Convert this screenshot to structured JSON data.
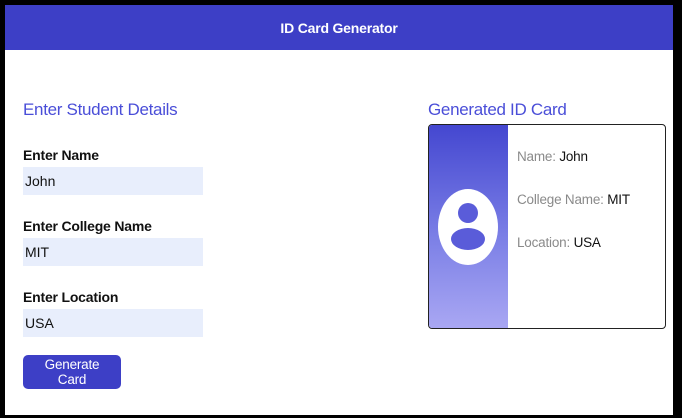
{
  "header": {
    "title": "ID Card Generator"
  },
  "form": {
    "section_title": "Enter Student Details",
    "name_label": "Enter Name",
    "name_value": "John",
    "college_label": "Enter College Name",
    "college_value": "MIT",
    "location_label": "Enter Location",
    "location_value": "USA",
    "button_label": "Generate Card"
  },
  "card": {
    "section_title": "Generated ID Card",
    "name_key": "Name:",
    "name_value": "John",
    "college_key": "College Name:",
    "college_value": "MIT",
    "location_key": "Location:",
    "location_value": "USA",
    "avatar_icon": "user-avatar-icon"
  },
  "colors": {
    "primary": "#3d3fc6",
    "accent_text": "#4a4ed8",
    "input_bg": "#e8eefc"
  }
}
